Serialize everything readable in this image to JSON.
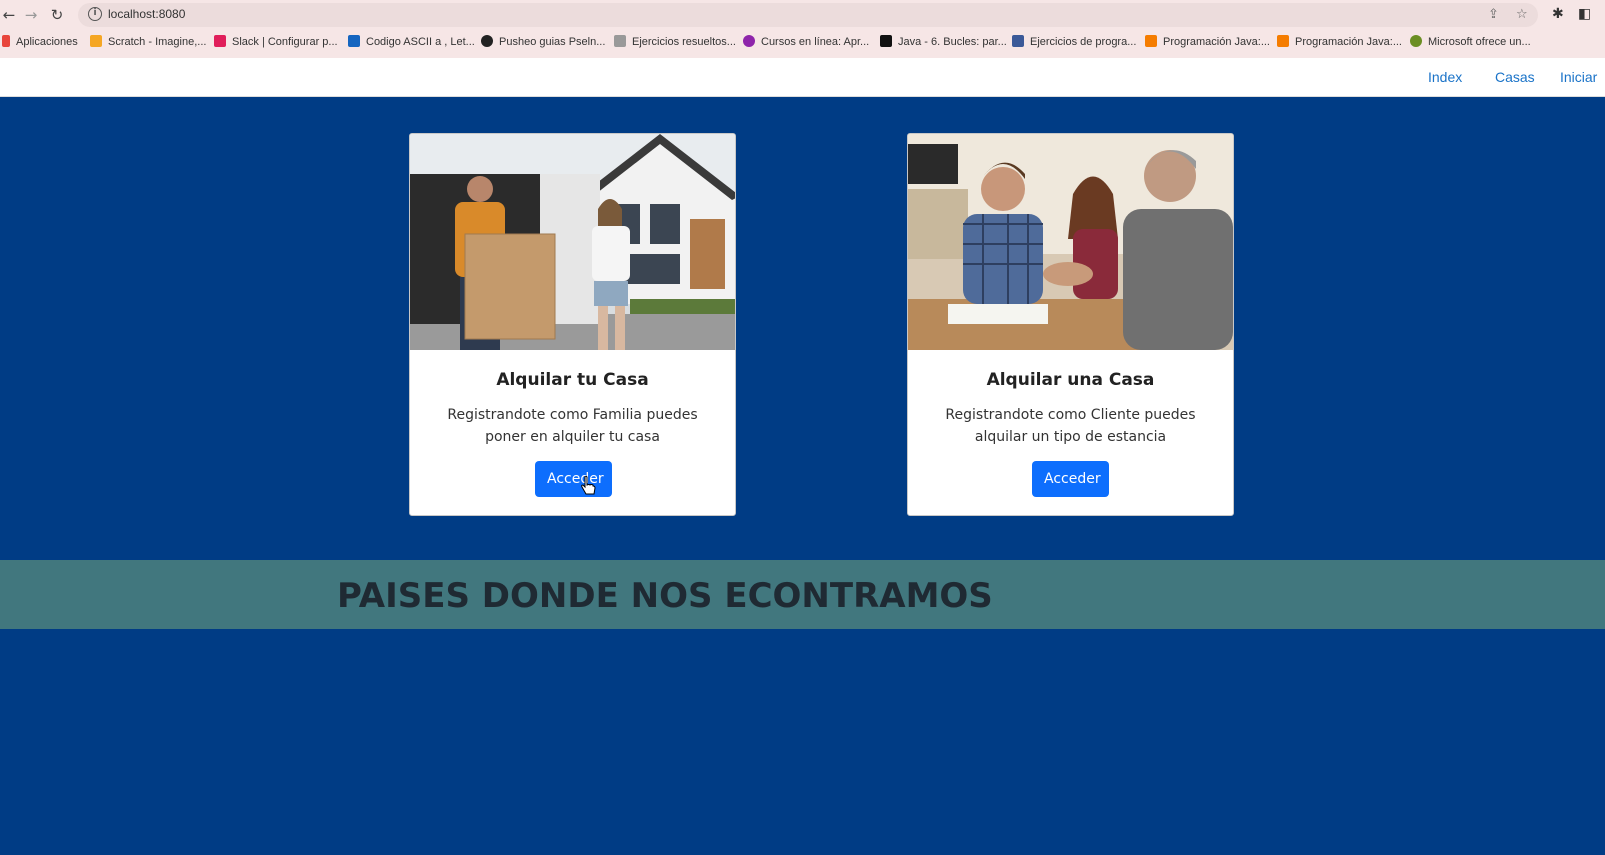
{
  "browser": {
    "url": "localhost:8080",
    "bookmarks": [
      {
        "label": "Aplicaciones",
        "color": "#e8453c"
      },
      {
        "label": "Scratch - Imagine,...",
        "color": "#f5a623"
      },
      {
        "label": "Slack | Configurar p...",
        "color": "#4a154b"
      },
      {
        "label": "Codigo ASCII a , Let...",
        "color": "#1565c0"
      },
      {
        "label": "Pusheo guias Pseln...",
        "color": "#222222"
      },
      {
        "label": "Ejercicios resueltos...",
        "color": "#888888"
      },
      {
        "label": "Cursos en línea: Apr...",
        "color": "#8e24aa"
      },
      {
        "label": "Java - 6. Bucles: par...",
        "color": "#111111"
      },
      {
        "label": "Ejercicios de progra...",
        "color": "#3b5998"
      },
      {
        "label": "Programación Java:...",
        "color": "#f57c00"
      },
      {
        "label": "Programación Java:...",
        "color": "#f57c00"
      },
      {
        "label": "Microsoft ofrece un...",
        "color": "#6b8e23"
      }
    ]
  },
  "navbar": {
    "links": [
      "Index",
      "Casas",
      "Iniciar"
    ]
  },
  "cards": [
    {
      "title": "Alquilar tu Casa",
      "text": "Registrandote como Familia puedes poner en alquiler tu casa",
      "button": "Acceder"
    },
    {
      "title": "Alquilar una Casa",
      "text": "Registrandote como Cliente puedes alquilar un tipo de estancia",
      "button": "Acceder"
    }
  ],
  "section": {
    "title": "PAISES DONDE NOS ECONTRAMOS"
  },
  "colors": {
    "page_bg": "#003c85",
    "band_bg": "#41777e",
    "link": "#1a73c8",
    "button": "#0d6efd"
  }
}
